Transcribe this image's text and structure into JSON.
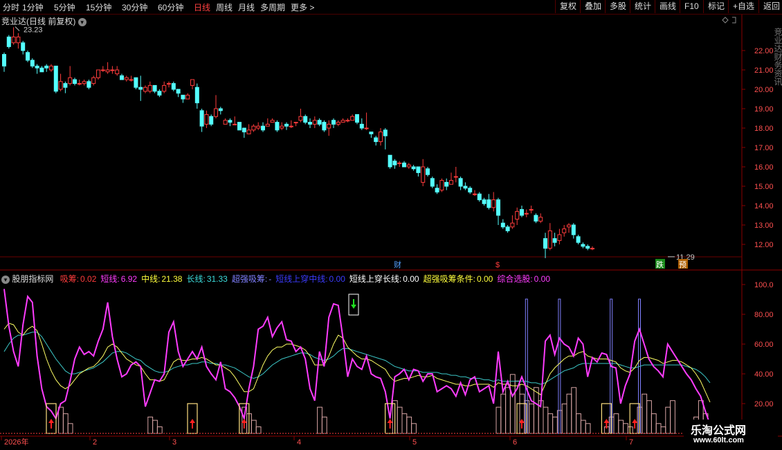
{
  "toolbar": {
    "periods": [
      "分时",
      "1分钟",
      "5分钟",
      "15分钟",
      "30分钟",
      "60分钟",
      "日线",
      "周线",
      "月线",
      "多周期",
      "更多 >"
    ],
    "active_period": "日线",
    "right_buttons": [
      "复权",
      "叠加",
      "多股",
      "统计",
      "画线",
      "F10",
      "标记",
      "+自选",
      "返回"
    ]
  },
  "main": {
    "title": "竞业达(日线 前复权)",
    "max_label": "23.23",
    "min_label": "11.29",
    "marks": {
      "cai": "财",
      "dollar": "$",
      "die": "跌",
      "yu": "预"
    },
    "right_labels": [
      "22.00",
      "21.00",
      "20.00",
      "19.00",
      "18.00",
      "17.00",
      "16.00",
      "15.00",
      "14.00",
      "13.00",
      "12.00"
    ],
    "right_edge_text": "竞业达财务资讯"
  },
  "indicator": {
    "name": "股朋指标网",
    "fields": [
      {
        "label": "吸筹:",
        "value": "0.02",
        "color": "#ff3c3c"
      },
      {
        "label": "短线:",
        "value": "6.92",
        "color": "#ff3cff"
      },
      {
        "label": "中线:",
        "value": "21.38",
        "color": "#ffff3c"
      },
      {
        "label": "长线:",
        "value": "31.33",
        "color": "#3cdcdc"
      },
      {
        "label": "超强吸筹:",
        "value": "-",
        "color": "#8080ff"
      },
      {
        "label": "短线上穿中线:",
        "value": "0.00",
        "color": "#3c3cff"
      },
      {
        "label": "短线上穿长线:",
        "value": "0.00",
        "color": "#ffffff"
      },
      {
        "label": "超强吸筹条件:",
        "value": "0.00",
        "color": "#ffff3c"
      },
      {
        "label": "综合选股:",
        "value": "0.00",
        "color": "#ff3cff"
      }
    ],
    "right_labels": [
      "100.0",
      "80.00",
      "60.00",
      "40.00",
      "20.00"
    ]
  },
  "xaxis": {
    "labels": [
      "2026年",
      "2",
      "3",
      "4",
      "5",
      "6",
      "7"
    ]
  },
  "watermark": {
    "line1": "乐淘公式网",
    "line2": "www.60lt.com"
  },
  "chart_data": {
    "type": "candlestick",
    "title": "竞业达(日线 前复权)",
    "ylim": [
      11.3,
      23.5
    ],
    "candles": [
      [
        21.8,
        21.2,
        21.9,
        20.9
      ],
      [
        22.7,
        22.2,
        22.8,
        22.1
      ],
      [
        22.4,
        22.7,
        23.2,
        22.3
      ],
      [
        22.4,
        22.7,
        22.9,
        22.1
      ],
      [
        22.4,
        22.0,
        22.5,
        21.8
      ],
      [
        21.9,
        21.5,
        22.0,
        21.4
      ],
      [
        21.5,
        21.2,
        21.6,
        21.1
      ],
      [
        21.2,
        21.1,
        21.3,
        20.8
      ],
      [
        21.1,
        20.9,
        21.2,
        20.9
      ],
      [
        21.2,
        21.1,
        21.3,
        20.9
      ],
      [
        21.0,
        21.2,
        21.3,
        20.9
      ],
      [
        21.2,
        19.9,
        21.2,
        19.8
      ],
      [
        20.0,
        20.4,
        20.8,
        19.9
      ],
      [
        20.3,
        20.1,
        20.4,
        19.8
      ],
      [
        20.3,
        20.6,
        21.2,
        20.2
      ],
      [
        20.5,
        20.3,
        20.6,
        20.2
      ],
      [
        20.3,
        20.3,
        20.5,
        20.2
      ],
      [
        20.3,
        20.4,
        20.5,
        20.2
      ],
      [
        20.4,
        20.1,
        20.5,
        20.0
      ],
      [
        20.3,
        20.6,
        20.7,
        20.2
      ],
      [
        20.6,
        21.0,
        21.0,
        20.5
      ],
      [
        21.0,
        21.0,
        21.2,
        20.9
      ],
      [
        20.9,
        21.0,
        21.4,
        20.8
      ],
      [
        21.0,
        21.0,
        21.2,
        20.8
      ],
      [
        20.8,
        21.0,
        21.2,
        20.7
      ],
      [
        20.7,
        20.5,
        20.8,
        20.5
      ],
      [
        20.5,
        20.6,
        20.7,
        20.4
      ],
      [
        20.5,
        20.5,
        20.7,
        20.4
      ],
      [
        20.6,
        20.1,
        20.6,
        20.0
      ],
      [
        20.1,
        20.0,
        20.7,
        19.4
      ],
      [
        19.9,
        20.1,
        20.2,
        19.8
      ],
      [
        19.9,
        20.2,
        20.4,
        19.8
      ],
      [
        20.2,
        19.9,
        20.2,
        19.8
      ],
      [
        19.9,
        19.7,
        20.0,
        19.6
      ],
      [
        19.9,
        20.2,
        20.4,
        19.8
      ],
      [
        20.3,
        20.3,
        20.4,
        20.1
      ],
      [
        20.3,
        20.0,
        20.4,
        19.9
      ],
      [
        20.0,
        19.8,
        20.0,
        19.6
      ],
      [
        19.7,
        19.5,
        19.7,
        19.3
      ],
      [
        19.5,
        19.7,
        19.8,
        19.5
      ],
      [
        20.2,
        20.5,
        20.5,
        20.0
      ],
      [
        20.1,
        19.3,
        20.3,
        19.0
      ],
      [
        18.9,
        18.1,
        19.0,
        17.8
      ],
      [
        18.2,
        18.7,
        18.9,
        18.0
      ],
      [
        18.6,
        18.2,
        18.7,
        18.1
      ],
      [
        18.6,
        19.0,
        19.7,
        18.5
      ],
      [
        19.0,
        18.9,
        19.1,
        18.7
      ],
      [
        18.2,
        18.4,
        18.5,
        18.2
      ],
      [
        18.4,
        18.3,
        18.5,
        18.1
      ],
      [
        18.2,
        18.2,
        18.6,
        18.2
      ],
      [
        18.3,
        17.9,
        18.3,
        17.9
      ],
      [
        18.0,
        17.8,
        18.0,
        17.5
      ],
      [
        17.7,
        17.9,
        18.2,
        17.7
      ],
      [
        17.9,
        18.1,
        18.2,
        17.8
      ],
      [
        18.0,
        18.1,
        18.3,
        17.9
      ],
      [
        18.1,
        17.9,
        18.3,
        17.8
      ],
      [
        18.1,
        18.2,
        18.5,
        18.1
      ],
      [
        18.3,
        18.4,
        18.5,
        18.3
      ],
      [
        18.3,
        17.9,
        18.4,
        17.8
      ],
      [
        18.0,
        18.1,
        18.3,
        17.9
      ],
      [
        18.2,
        18.1,
        18.3,
        17.9
      ],
      [
        18.1,
        18.1,
        18.4,
        18.0
      ],
      [
        18.3,
        18.3,
        18.3,
        18.1
      ],
      [
        18.4,
        18.6,
        19.0,
        18.3
      ],
      [
        18.6,
        18.3,
        18.7,
        18.2
      ],
      [
        18.3,
        18.2,
        18.5,
        18.0
      ],
      [
        18.2,
        18.4,
        18.6,
        18.0
      ],
      [
        18.4,
        18.2,
        18.5,
        18.1
      ],
      [
        18.3,
        17.9,
        18.4,
        17.8
      ],
      [
        18.0,
        18.2,
        18.4,
        17.6
      ],
      [
        18.4,
        18.2,
        18.5,
        18.0
      ],
      [
        18.2,
        18.3,
        18.4,
        18.1
      ],
      [
        18.3,
        18.4,
        18.5,
        18.3
      ],
      [
        18.4,
        18.4,
        18.5,
        18.3
      ],
      [
        18.4,
        18.6,
        18.7,
        18.4
      ],
      [
        18.7,
        18.3,
        18.7,
        18.2
      ],
      [
        18.2,
        18.0,
        18.5,
        17.9
      ],
      [
        18.0,
        18.0,
        18.8,
        17.9
      ],
      [
        17.8,
        17.7,
        17.8,
        17.5
      ],
      [
        17.5,
        17.3,
        17.6,
        17.1
      ],
      [
        17.3,
        17.8,
        18.0,
        17.1
      ],
      [
        17.9,
        17.6,
        18.0,
        16.9
      ],
      [
        16.6,
        16.0,
        16.6,
        15.9
      ],
      [
        16.3,
        16.1,
        16.4,
        15.9
      ],
      [
        16.2,
        16.2,
        16.3,
        16.0
      ],
      [
        16.2,
        16.0,
        16.3,
        16.0
      ],
      [
        16.0,
        16.1,
        16.2,
        15.9
      ],
      [
        16.0,
        15.9,
        16.1,
        15.8
      ],
      [
        16.0,
        15.7,
        16.0,
        15.5
      ],
      [
        15.2,
        16.0,
        16.4,
        15.0
      ],
      [
        15.9,
        15.6,
        16.0,
        15.5
      ],
      [
        15.4,
        15.0,
        15.5,
        14.9
      ],
      [
        14.9,
        14.7,
        15.1,
        14.6
      ],
      [
        14.8,
        15.3,
        15.4,
        14.7
      ],
      [
        15.2,
        15.0,
        15.4,
        14.8
      ],
      [
        15.1,
        15.3,
        15.7,
        15.1
      ],
      [
        15.5,
        15.5,
        16.0,
        15.2
      ],
      [
        15.4,
        15.0,
        15.5,
        14.8
      ],
      [
        15.0,
        14.9,
        15.2,
        14.8
      ],
      [
        14.9,
        14.7,
        15.0,
        14.6
      ],
      [
        14.6,
        14.6,
        14.8,
        14.5
      ],
      [
        14.6,
        14.3,
        14.7,
        14.2
      ],
      [
        14.3,
        14.1,
        14.4,
        14.0
      ],
      [
        14.3,
        13.9,
        14.6,
        13.8
      ],
      [
        13.9,
        14.3,
        14.7,
        13.7
      ],
      [
        14.3,
        13.5,
        14.4,
        13.0
      ],
      [
        13.1,
        12.9,
        13.3,
        12.8
      ],
      [
        12.9,
        12.7,
        13.0,
        12.6
      ],
      [
        12.9,
        13.1,
        13.5,
        12.8
      ],
      [
        13.3,
        13.7,
        13.9,
        13.0
      ],
      [
        13.8,
        13.5,
        14.0,
        13.4
      ],
      [
        13.6,
        13.6,
        13.8,
        13.4
      ],
      [
        13.8,
        13.8,
        14.0,
        13.6
      ],
      [
        13.5,
        13.2,
        13.6,
        13.1
      ],
      [
        13.2,
        13.4,
        13.6,
        13.1
      ],
      [
        12.3,
        11.8,
        12.6,
        11.29
      ],
      [
        11.8,
        12.7,
        13.1,
        11.7
      ],
      [
        12.3,
        12.1,
        12.6,
        11.9
      ],
      [
        12.2,
        12.5,
        12.8,
        12.0
      ],
      [
        12.6,
        12.8,
        13.0,
        12.4
      ],
      [
        12.9,
        13.0,
        13.1,
        12.6
      ],
      [
        13.0,
        12.5,
        13.1,
        12.3
      ],
      [
        12.4,
        12.1,
        12.5,
        12.0
      ],
      [
        12.0,
        11.9,
        12.1,
        11.8
      ],
      [
        11.9,
        11.8,
        12.0,
        11.7
      ],
      [
        11.8,
        11.8,
        11.9,
        11.7
      ]
    ],
    "indicator": {
      "ylim": [
        0,
        105
      ],
      "short": [
        97,
        72,
        55,
        45,
        73,
        92,
        88,
        52,
        30,
        18,
        15,
        10,
        20,
        22,
        35,
        50,
        58,
        53,
        55,
        52,
        62,
        70,
        88,
        65,
        50,
        38,
        40,
        46,
        48,
        45,
        18,
        27,
        36,
        35,
        40,
        68,
        75,
        55,
        45,
        50,
        55,
        50,
        58,
        45,
        40,
        36,
        48,
        30,
        28,
        24,
        18,
        10,
        30,
        45,
        70,
        72,
        78,
        65,
        71,
        75,
        63,
        62,
        55,
        58,
        50,
        30,
        22,
        55,
        45,
        78,
        87,
        86,
        64,
        38,
        50,
        45,
        43,
        52,
        40,
        38,
        37,
        28,
        10,
        38,
        40,
        43,
        36,
        43,
        42,
        35,
        40,
        40,
        28,
        30,
        32,
        30,
        25,
        34,
        26,
        36,
        38,
        28,
        30,
        32,
        20,
        55,
        28,
        35,
        25,
        30,
        38,
        30,
        22,
        20,
        18,
        62,
        66,
        53,
        64,
        60,
        58,
        52,
        64,
        60,
        38,
        51,
        48,
        54,
        53,
        45,
        44,
        20,
        32,
        40,
        62,
        70,
        60,
        50,
        45,
        42,
        38,
        60,
        55,
        50,
        45,
        40,
        36,
        30,
        25,
        15,
        6
      ],
      "mid": [
        70,
        74,
        73,
        68,
        66,
        70,
        72,
        69,
        60,
        50,
        42,
        36,
        32,
        30,
        32,
        36,
        40,
        42,
        44,
        45,
        48,
        52,
        58,
        60,
        58,
        54,
        50,
        48,
        46,
        45,
        40,
        36,
        36,
        35,
        36,
        42,
        48,
        50,
        49,
        49,
        50,
        50,
        51,
        50,
        48,
        46,
        46,
        44,
        42,
        38,
        33,
        28,
        28,
        30,
        38,
        46,
        52,
        56,
        58,
        58,
        60,
        60,
        59,
        58,
        56,
        52,
        46,
        46,
        46,
        52,
        60,
        66,
        64,
        58,
        55,
        52,
        50,
        50,
        49,
        47,
        45,
        43,
        38,
        35,
        36,
        37,
        37,
        38,
        39,
        38,
        38,
        39,
        37,
        36,
        35,
        34,
        33,
        33,
        32,
        32,
        33,
        33,
        33,
        33,
        31,
        34,
        33,
        33,
        32,
        32,
        33,
        32,
        30,
        28,
        26,
        33,
        40,
        44,
        47,
        50,
        52,
        52,
        54,
        55,
        52,
        51,
        50,
        50,
        50,
        49,
        48,
        44,
        42,
        41,
        44,
        49,
        51,
        51,
        50,
        49,
        47,
        48,
        49,
        49,
        48,
        46,
        44,
        40,
        35,
        28,
        21
      ],
      "long": [
        55,
        60,
        64,
        66,
        66,
        67,
        68,
        68,
        65,
        60,
        55,
        50,
        46,
        42,
        40,
        40,
        41,
        42,
        43,
        44,
        46,
        48,
        51,
        54,
        55,
        55,
        54,
        52,
        50,
        49,
        46,
        44,
        42,
        41,
        41,
        42,
        44,
        45,
        46,
        46,
        47,
        47,
        48,
        48,
        47,
        47,
        46,
        46,
        45,
        44,
        42,
        40,
        38,
        37,
        38,
        40,
        43,
        46,
        48,
        50,
        51,
        52,
        53,
        54,
        54,
        53,
        51,
        50,
        49,
        50,
        52,
        55,
        57,
        57,
        56,
        55,
        54,
        53,
        52,
        51,
        50,
        49,
        47,
        45,
        44,
        43,
        42,
        42,
        42,
        41,
        41,
        41,
        41,
        40,
        40,
        39,
        39,
        38,
        38,
        37,
        37,
        37,
        36,
        36,
        35,
        36,
        35,
        35,
        35,
        35,
        35,
        35,
        34,
        34,
        33,
        34,
        36,
        38,
        40,
        42,
        43,
        44,
        46,
        47,
        47,
        47,
        47,
        47,
        47,
        47,
        47,
        46,
        45,
        44,
        44,
        45,
        46,
        46,
        46,
        46,
        46,
        46,
        46,
        46,
        46,
        45,
        44,
        43,
        41,
        38,
        34
      ],
      "accum": [
        0,
        0,
        0,
        0,
        0,
        0,
        0,
        0,
        0,
        0,
        0,
        0,
        8,
        6,
        3,
        0,
        0,
        0,
        0,
        0,
        0,
        0,
        0,
        0,
        0,
        0,
        0,
        0,
        0,
        0,
        0,
        5,
        4,
        2,
        0,
        0,
        0,
        0,
        0,
        0,
        0,
        0,
        0,
        0,
        0,
        0,
        0,
        0,
        0,
        0,
        0,
        8,
        6,
        4,
        2,
        0,
        0,
        0,
        0,
        0,
        0,
        0,
        0,
        0,
        0,
        0,
        0,
        8,
        5,
        0,
        0,
        0,
        0,
        0,
        0,
        0,
        0,
        0,
        0,
        0,
        0,
        0,
        0,
        10,
        8,
        6,
        5,
        3,
        0,
        0,
        0,
        0,
        0,
        0,
        0,
        0,
        0,
        0,
        0,
        0,
        0,
        0,
        0,
        0,
        0,
        8,
        12,
        14,
        18,
        16,
        12,
        10,
        9,
        14,
        10,
        8,
        6,
        5,
        7,
        9,
        12,
        14,
        6,
        4,
        3,
        0,
        0,
        0,
        2,
        5,
        6,
        4,
        3,
        2,
        0,
        8,
        12,
        10,
        6,
        3,
        2,
        8,
        10,
        0,
        0,
        0,
        0,
        5,
        10,
        6,
        3,
        0
      ],
      "up_arrows": [
        10,
        40,
        51,
        82,
        110,
        128,
        134
      ],
      "down_arrow": 57,
      "vlines": [
        111,
        118,
        129,
        135
      ]
    }
  }
}
